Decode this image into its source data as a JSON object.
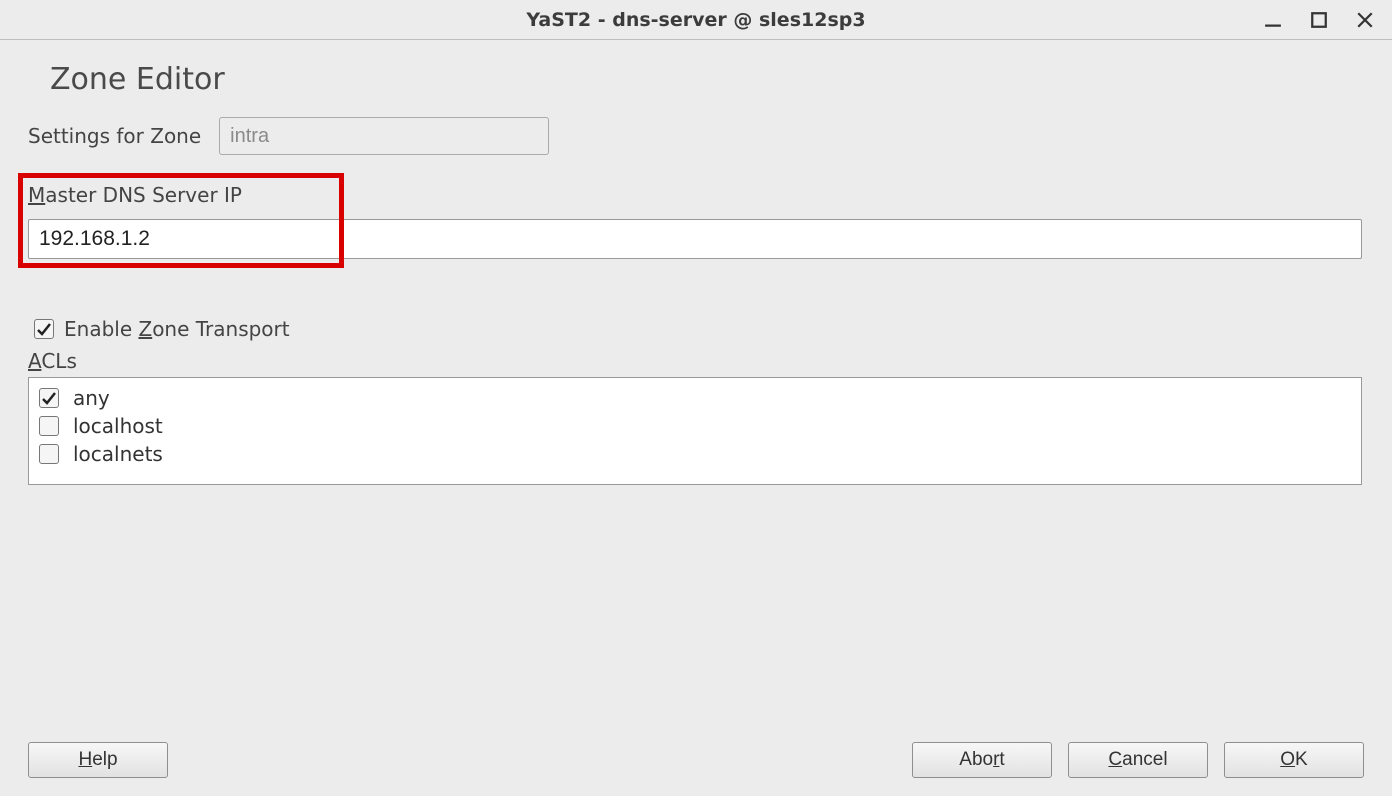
{
  "window": {
    "title": "YaST2 - dns-server @ sles12sp3"
  },
  "heading": "Zone Editor",
  "zone": {
    "label": "Settings for Zone",
    "value": "intra"
  },
  "master_ip": {
    "label_pre": "",
    "label_u": "M",
    "label_post": "aster DNS Server IP",
    "value": "192.168.1.2"
  },
  "enable_transport": {
    "label_pre": "Enable ",
    "label_u": "Z",
    "label_post": "one Transport",
    "checked": true
  },
  "acls": {
    "label_u": "A",
    "label_post": "CLs",
    "items": [
      {
        "label": "any",
        "checked": true
      },
      {
        "label": "localhost",
        "checked": false
      },
      {
        "label": "localnets",
        "checked": false
      }
    ]
  },
  "buttons": {
    "help_u": "H",
    "help_post": "elp",
    "abort_pre": "Abo",
    "abort_u": "r",
    "abort_post": "t",
    "cancel_u": "C",
    "cancel_post": "ancel",
    "ok_u": "O",
    "ok_post": "K"
  }
}
